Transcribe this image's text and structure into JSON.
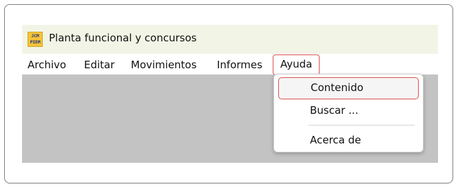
{
  "window": {
    "title": "Planta funcional y concursos",
    "logo_text_top": "JCM",
    "logo_text_bottom": "PIEM"
  },
  "menubar": {
    "items": [
      {
        "label": "Archivo"
      },
      {
        "label": "Editar"
      },
      {
        "label": "Movimientos"
      },
      {
        "label": "Informes"
      },
      {
        "label": "Ayuda",
        "active": true
      }
    ]
  },
  "dropdown": {
    "items": [
      {
        "label": "Contenido",
        "highlighted": true
      },
      {
        "label": "Buscar ..."
      },
      {
        "label": "Acerca de"
      }
    ]
  },
  "colors": {
    "titlebar_bg": "#f2f5e6",
    "workspace_bg": "#c3c3c3",
    "highlight_border": "#d9534f",
    "logo_bg": "#f6c43a",
    "logo_fg": "#1b2f7a"
  }
}
